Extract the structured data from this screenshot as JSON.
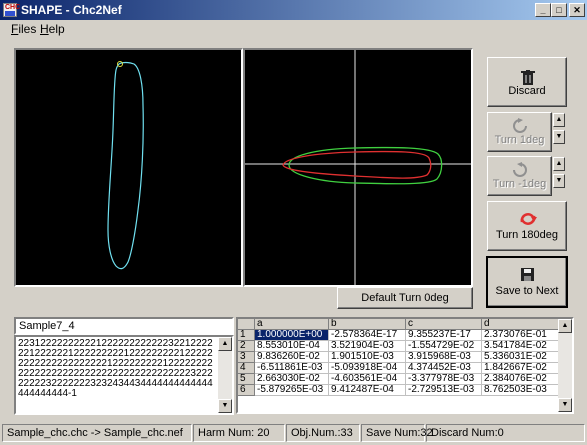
{
  "window": {
    "title": "SHAPE - Chc2Nef",
    "icon_text": "CHC",
    "minimize_icon": "minimize-icon",
    "maximize_icon": "maximize-icon",
    "close_icon": "close-icon"
  },
  "menu": [
    {
      "label": "Files",
      "underline": "F",
      "rest": "iles"
    },
    {
      "label": "Help",
      "underline": "H",
      "rest": "elp"
    }
  ],
  "colors": {
    "canvas_bg": "#000000",
    "left_contour": "#70e0f0",
    "right_red": "#e03030",
    "right_green": "#40d040",
    "crosshair": "#e8e8e8",
    "selected_cell": "#0a246a",
    "turn180_icon": "#e03030"
  },
  "buttons": {
    "discard": {
      "label": "Discard",
      "icon": "trash-icon"
    },
    "turn_pos": {
      "label": "Turn 1deg",
      "icon": "rotate-cw-icon"
    },
    "turn_neg": {
      "label": "Turn -1deg",
      "icon": "rotate-ccw-icon"
    },
    "turn180": {
      "label": "Turn 180deg",
      "icon": "rotate-180-icon"
    },
    "save_next": {
      "label": "Save to Next",
      "icon": "floppy-icon"
    },
    "default_turn": {
      "label": "Default Turn 0deg"
    }
  },
  "sample": {
    "name": "Sample7_4",
    "chain_code": "2231222222222212222222222223221222222122222212222222221222222222122222222222222222222212222222221222222222222222222222222222222222222222322222222322222223232434434444444444444444444444-1"
  },
  "grid": {
    "columns": [
      "a",
      "b",
      "c",
      "d"
    ],
    "rows": [
      {
        "num": "1",
        "cells": [
          "1.000000E+00",
          "-2.578364E-17",
          "9.355237E-17",
          "2.373076E-01"
        ]
      },
      {
        "num": "2",
        "cells": [
          "8.553010E-04",
          "3.521904E-03",
          "-1.554729E-02",
          "3.541784E-02"
        ]
      },
      {
        "num": "3",
        "cells": [
          "9.836260E-02",
          "1.901510E-03",
          "3.915968E-03",
          "5.336031E-02"
        ]
      },
      {
        "num": "4",
        "cells": [
          "-6.511861E-03",
          "-5.093918E-04",
          "4.374452E-03",
          "1.842667E-02"
        ]
      },
      {
        "num": "5",
        "cells": [
          "2.663030E-02",
          "-4.603561E-04",
          "-3.377978E-03",
          "2.384076E-02"
        ]
      },
      {
        "num": "6",
        "cells": [
          "-5.879265E-03",
          "9.412487E-04",
          "-2.729513E-03",
          "8.762503E-03"
        ]
      }
    ]
  },
  "status": {
    "files": "Sample_chc.chc -> Sample_chc.nef",
    "harm": "Harm Num: 20",
    "obj": "Obj.Num.:33",
    "save": "Save Num:32",
    "discard": "Discard Num:0"
  }
}
